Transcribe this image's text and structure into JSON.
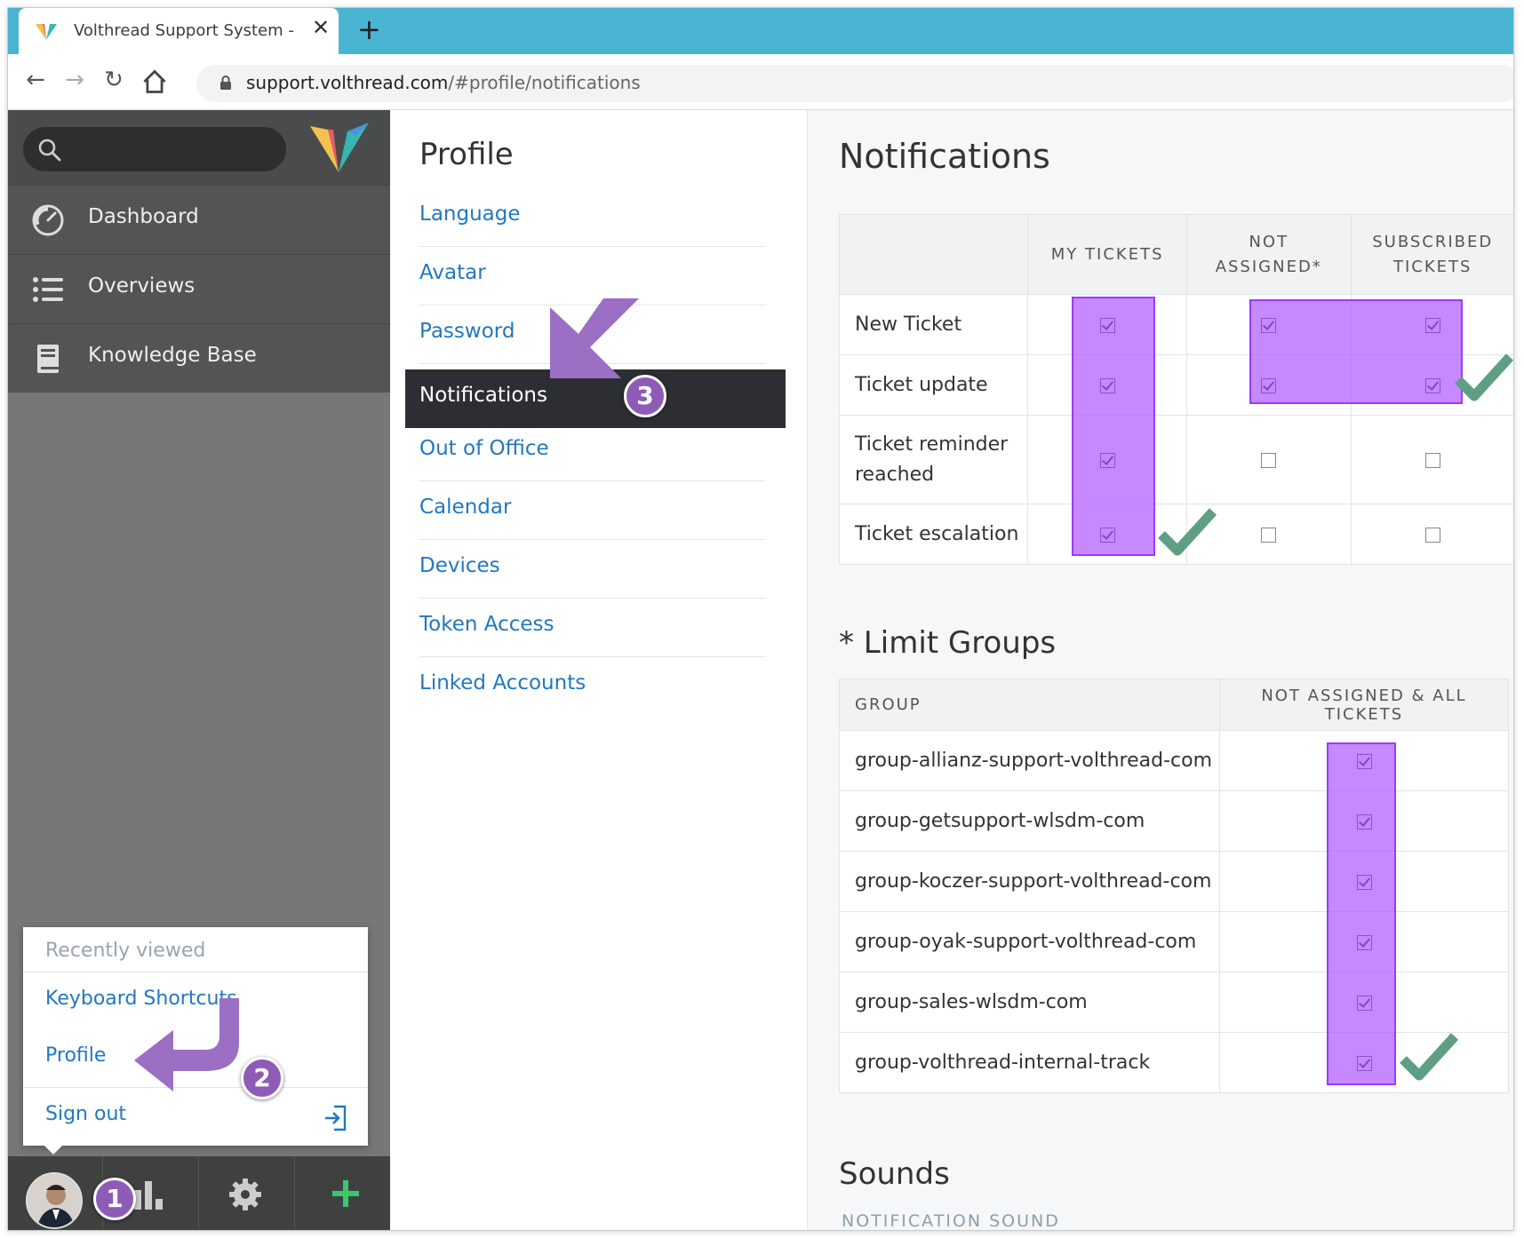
{
  "browser": {
    "tab_title": "Volthread Support System - Notifications",
    "url_host": "support.volthread.com",
    "url_path": "/#profile/notifications"
  },
  "sidebar": {
    "nav": [
      {
        "label": "Dashboard",
        "icon": "dashboard-icon"
      },
      {
        "label": "Overviews",
        "icon": "list-icon"
      },
      {
        "label": "Knowledge Base",
        "icon": "book-icon"
      }
    ],
    "popup": {
      "recently_viewed": "Recently viewed",
      "keyboard_shortcuts": "Keyboard Shortcuts",
      "profile": "Profile",
      "sign_out": "Sign out"
    }
  },
  "profile_menu": {
    "title": "Profile",
    "items": [
      "Language",
      "Avatar",
      "Password",
      "Notifications",
      "Out of Office",
      "Calendar",
      "Devices",
      "Token Access",
      "Linked Accounts"
    ],
    "active": "Notifications"
  },
  "notifications": {
    "title": "Notifications",
    "columns": [
      "MY TICKETS",
      "NOT ASSIGNED*",
      "SUBSCRIBED TICKETS"
    ],
    "rows": [
      {
        "label": "New Ticket",
        "checks": [
          true,
          true,
          true
        ]
      },
      {
        "label": "Ticket update",
        "checks": [
          true,
          true,
          true
        ]
      },
      {
        "label": "Ticket reminder reached",
        "checks": [
          true,
          false,
          false
        ]
      },
      {
        "label": "Ticket escalation",
        "checks": [
          true,
          false,
          false
        ]
      }
    ]
  },
  "limit_groups": {
    "title": "* Limit Groups",
    "col_group": "GROUP",
    "col_scope": "NOT ASSIGNED & ALL TICKETS",
    "groups": [
      {
        "name": "group-allianz-support-volthread-com",
        "checked": true
      },
      {
        "name": "group-getsupport-wlsdm-com",
        "checked": true
      },
      {
        "name": "group-koczer-support-volthread-com",
        "checked": true
      },
      {
        "name": "group-oyak-support-volthread-com",
        "checked": true
      },
      {
        "name": "group-sales-wlsdm-com",
        "checked": true
      },
      {
        "name": "group-volthread-internal-track",
        "checked": true
      }
    ]
  },
  "sounds": {
    "title": "Sounds",
    "notification_sound": "NOTIFICATION SOUND"
  },
  "annotations": {
    "step1": "1",
    "step2": "2",
    "step3": "3",
    "highlight_color": "#b25cff",
    "arrow_color": "#9b6fc4",
    "tick_color": "#5e9e85"
  }
}
